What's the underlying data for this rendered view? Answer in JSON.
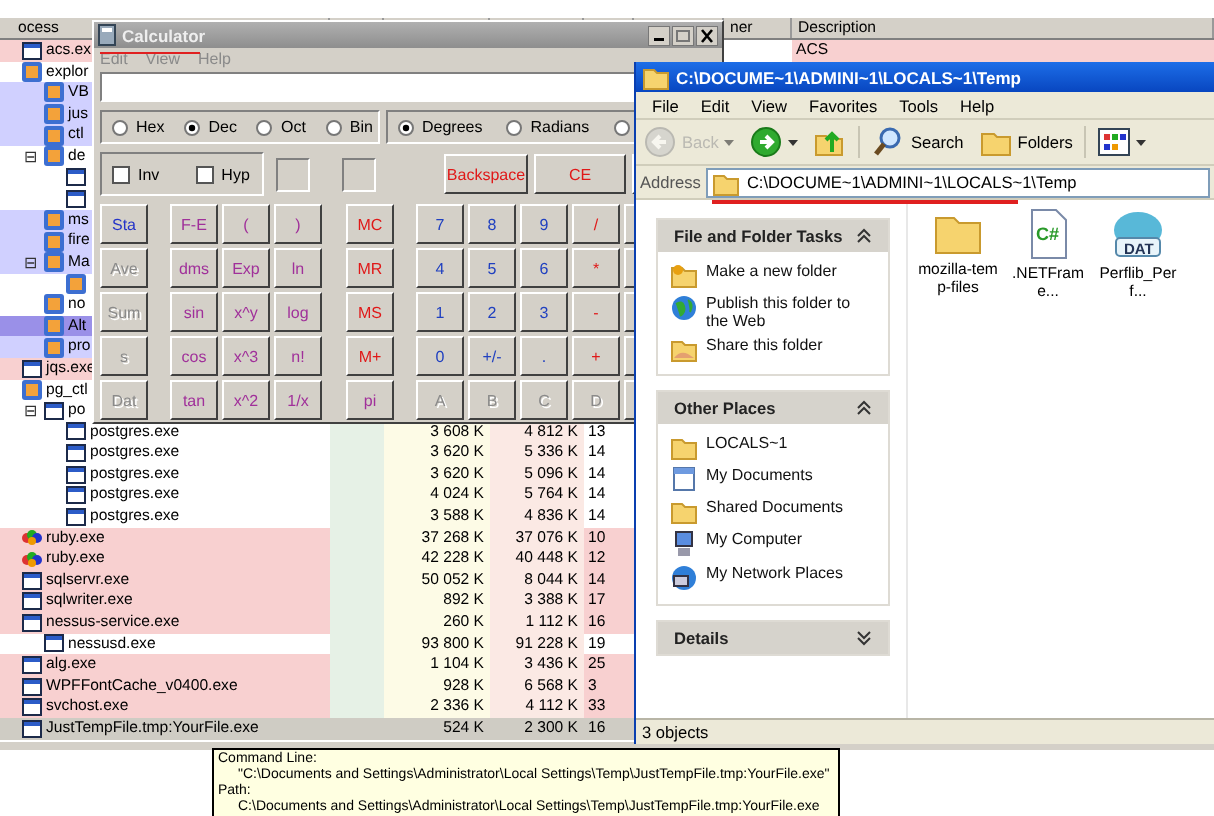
{
  "process_explorer": {
    "columns": [
      {
        "label": "ocess"
      },
      {
        "label": "ner"
      },
      {
        "label": "Description"
      }
    ],
    "processes": [
      {
        "name": "acs.ex",
        "kind": "window",
        "color": "#f8d0d0",
        "selected": false,
        "description": "ACS"
      },
      {
        "name": "explor",
        "kind": "app",
        "selected": false,
        "children": [
          {
            "name": "VB",
            "kind": "app",
            "color": "#d0d0ff",
            "selected": false
          },
          {
            "name": "jus",
            "kind": "app",
            "color": "#d0d0ff",
            "selected": false
          },
          {
            "name": "ctl",
            "kind": "app",
            "color": "#d0d0ff",
            "selected": false
          },
          {
            "name": "de",
            "kind": "app",
            "toggle": "⊟",
            "selected": false,
            "children": [
              {
                "kind": "window",
                "selected": false
              },
              {
                "kind": "window",
                "selected": false
              }
            ]
          },
          {
            "name": "ms",
            "kind": "app",
            "color": "#d0d0ff",
            "selected": false
          },
          {
            "name": "fire",
            "kind": "app",
            "color": "#d0d0ff",
            "selected": false
          },
          {
            "name": "Ma",
            "kind": "app",
            "toggle": "⊟",
            "color": "#d0d0ff",
            "selected": false,
            "children": [
              {
                "kind": "app",
                "selected": false
              }
            ]
          },
          {
            "name": "no",
            "kind": "app",
            "selected": false
          },
          {
            "name": "Alt",
            "kind": "app",
            "color": "#9a90e8",
            "selected": false
          },
          {
            "name": "pro",
            "kind": "app",
            "color": "#d0d0ff",
            "selected": false
          }
        ]
      },
      {
        "name": "jqs.exe",
        "kind": "window",
        "color": "#f8d0d0",
        "selected": false
      },
      {
        "name": "pg_ctl",
        "kind": "app",
        "selected": false,
        "children": [
          {
            "name": "po",
            "kind": "window",
            "toggle": "⊟",
            "selected": false,
            "children": [
              {
                "name": "postgres.exe",
                "kind": "window",
                "selected": false,
                "private_bytes": "3 608 K",
                "working_set": "4 812 K",
                "pid": "13"
              },
              {
                "name": "postgres.exe",
                "kind": "window",
                "selected": false,
                "private_bytes": "3 620 K",
                "working_set": "5 336 K",
                "pid": "14"
              },
              {
                "name": "postgres.exe",
                "kind": "window",
                "selected": false,
                "private_bytes": "3 620 K",
                "working_set": "5 096 K",
                "pid": "14"
              },
              {
                "name": "postgres.exe",
                "kind": "window",
                "selected": false,
                "private_bytes": "4 024 K",
                "working_set": "5 764 K",
                "pid": "14"
              },
              {
                "name": "postgres.exe",
                "kind": "window",
                "selected": false,
                "private_bytes": "3 588 K",
                "working_set": "4 836 K",
                "pid": "14"
              }
            ]
          }
        ]
      },
      {
        "name": "ruby.exe",
        "kind": "gem",
        "color": "#f8d0d0",
        "selected": false,
        "private_bytes": "37 268 K",
        "working_set": "37 076 K",
        "pid": "10"
      },
      {
        "name": "ruby.exe",
        "kind": "gem",
        "color": "#f8d0d0",
        "selected": false,
        "private_bytes": "42 228 K",
        "working_set": "40 448 K",
        "pid": "12"
      },
      {
        "name": "sqlservr.exe",
        "kind": "window",
        "color": "#f8d0d0",
        "selected": false,
        "private_bytes": "50 052 K",
        "working_set": "8 044 K",
        "pid": "14"
      },
      {
        "name": "sqlwriter.exe",
        "kind": "window",
        "color": "#f8d0d0",
        "selected": false,
        "private_bytes": "892 K",
        "working_set": "3 388 K",
        "pid": "17"
      },
      {
        "name": "nessus-service.exe",
        "kind": "window",
        "color": "#f8d0d0",
        "selected": false,
        "private_bytes": "260 K",
        "working_set": "1 112 K",
        "pid": "16",
        "children": [
          {
            "name": "nessusd.exe",
            "kind": "window",
            "selected": false,
            "private_bytes": "93 800 K",
            "working_set": "91 228 K",
            "pid": "19"
          }
        ]
      },
      {
        "name": "alg.exe",
        "kind": "window",
        "color": "#f8d0d0",
        "selected": false,
        "private_bytes": "1 104 K",
        "working_set": "3 436 K",
        "pid": "25"
      },
      {
        "name": "WPFFontCache_v0400.exe",
        "kind": "window",
        "color": "#f8d0d0",
        "selected": false,
        "private_bytes": "928 K",
        "working_set": "6 568 K",
        "pid": "3"
      },
      {
        "name": "svchost.exe",
        "kind": "window",
        "color": "#f8d0d0",
        "selected": false,
        "private_bytes": "2 336 K",
        "working_set": "4 112 K",
        "pid": "33"
      },
      {
        "name": "JustTempFile.tmp:YourFile.exe",
        "kind": "window",
        "selected": true,
        "annotated": true,
        "private_bytes": "524 K",
        "working_set": "2 300 K",
        "pid": "16"
      }
    ]
  },
  "calculator": {
    "title": "Calculator",
    "annotated": true,
    "menu": [
      "Edit",
      "View",
      "Help"
    ],
    "bases": [
      {
        "label": "Hex",
        "selected": false
      },
      {
        "label": "Dec",
        "selected": true
      },
      {
        "label": "Oct",
        "selected": false
      },
      {
        "label": "Bin",
        "selected": false
      }
    ],
    "angles": [
      {
        "label": "Degrees",
        "selected": true
      },
      {
        "label": "Radians",
        "selected": false
      },
      {
        "selected": false
      }
    ],
    "checks": [
      {
        "label": "Inv",
        "checked": false
      },
      {
        "label": "Hyp",
        "checked": false
      }
    ],
    "edit_keys": [
      "Backspace",
      "CE"
    ],
    "keys": [
      [
        {
          "label": "Sta",
          "kind": "stat",
          "disabled": false
        },
        {
          "label": "F-E",
          "kind": "func",
          "disabled": false
        },
        {
          "label": "(",
          "kind": "func",
          "disabled": false
        },
        {
          "label": ")",
          "kind": "func",
          "disabled": false
        },
        {
          "label": "MC",
          "kind": "mem",
          "disabled": false
        },
        {
          "label": "7",
          "kind": "digit",
          "disabled": false
        },
        {
          "label": "8",
          "kind": "digit",
          "disabled": false
        },
        {
          "label": "9",
          "kind": "digit",
          "disabled": false
        },
        {
          "label": "/",
          "kind": "op",
          "disabled": false
        },
        {
          "kind": "op"
        }
      ],
      [
        {
          "label": "Ave",
          "kind": "stat",
          "disabled": true
        },
        {
          "label": "dms",
          "kind": "func",
          "disabled": false
        },
        {
          "label": "Exp",
          "kind": "func",
          "disabled": false
        },
        {
          "label": "ln",
          "kind": "func",
          "disabled": false
        },
        {
          "label": "MR",
          "kind": "mem",
          "disabled": false
        },
        {
          "label": "4",
          "kind": "digit",
          "disabled": false
        },
        {
          "label": "5",
          "kind": "digit",
          "disabled": false
        },
        {
          "label": "6",
          "kind": "digit",
          "disabled": false
        },
        {
          "label": "*",
          "kind": "op",
          "disabled": false
        },
        {
          "kind": "op"
        }
      ],
      [
        {
          "label": "Sum",
          "kind": "stat",
          "disabled": true
        },
        {
          "label": "sin",
          "kind": "func",
          "disabled": false
        },
        {
          "label": "x^y",
          "kind": "func",
          "disabled": false
        },
        {
          "label": "log",
          "kind": "func",
          "disabled": false
        },
        {
          "label": "MS",
          "kind": "mem",
          "disabled": false
        },
        {
          "label": "1",
          "kind": "digit",
          "disabled": false
        },
        {
          "label": "2",
          "kind": "digit",
          "disabled": false
        },
        {
          "label": "3",
          "kind": "digit",
          "disabled": false
        },
        {
          "label": "-",
          "kind": "op",
          "disabled": false
        },
        {
          "kind": "op"
        }
      ],
      [
        {
          "label": "s",
          "kind": "stat",
          "disabled": true
        },
        {
          "label": "cos",
          "kind": "func",
          "disabled": false
        },
        {
          "label": "x^3",
          "kind": "func",
          "disabled": false
        },
        {
          "label": "n!",
          "kind": "func",
          "disabled": false
        },
        {
          "label": "M+",
          "kind": "mem",
          "disabled": false
        },
        {
          "label": "0",
          "kind": "digit",
          "disabled": false
        },
        {
          "label": "+/-",
          "kind": "digit",
          "disabled": false
        },
        {
          "label": ".",
          "kind": "digit",
          "disabled": false
        },
        {
          "label": "+",
          "kind": "op",
          "disabled": false
        },
        {
          "kind": "op"
        }
      ],
      [
        {
          "label": "Dat",
          "kind": "stat",
          "disabled": true
        },
        {
          "label": "tan",
          "kind": "func",
          "disabled": false
        },
        {
          "label": "x^2",
          "kind": "func",
          "disabled": false
        },
        {
          "label": "1/x",
          "kind": "func",
          "disabled": false
        },
        {
          "label": "pi",
          "kind": "func",
          "disabled": false
        },
        {
          "label": "A",
          "kind": "digit",
          "disabled": true
        },
        {
          "label": "B",
          "kind": "digit",
          "disabled": true
        },
        {
          "label": "C",
          "kind": "digit",
          "disabled": true
        },
        {
          "label": "D",
          "kind": "digit",
          "disabled": true
        },
        {
          "kind": "op"
        }
      ]
    ]
  },
  "explorer": {
    "title": "C:\\DOCUME~1\\ADMINI~1\\LOCALS~1\\Temp",
    "menu": [
      "File",
      "Edit",
      "View",
      "Favorites",
      "Tools",
      "Help"
    ],
    "toolbar": [
      {
        "kind": "back",
        "label": "Back",
        "disabled": true
      },
      {
        "kind": "forward",
        "disabled": false
      },
      {
        "kind": "up",
        "disabled": false
      },
      {
        "kind": "search",
        "label": "Search",
        "disabled": false
      },
      {
        "kind": "folders",
        "label": "Folders",
        "disabled": false
      },
      {
        "kind": "views",
        "disabled": false
      }
    ],
    "address": {
      "label": "Address",
      "value": "C:\\DOCUME~1\\ADMINI~1\\LOCALS~1\\Temp",
      "annotated": true
    },
    "panels": [
      {
        "title": "File and Folder Tasks",
        "expanded": true,
        "items": [
          {
            "label": "Make a new folder",
            "kind": "new-folder"
          },
          {
            "label": "Publish this folder to the Web",
            "kind": "globe"
          },
          {
            "label": "Share this folder",
            "kind": "share"
          }
        ]
      },
      {
        "title": "Other Places",
        "expanded": true,
        "items": [
          {
            "label": "LOCALS~1",
            "kind": "folder"
          },
          {
            "label": "My Documents",
            "kind": "documents"
          },
          {
            "label": "Shared Documents",
            "kind": "folder"
          },
          {
            "label": "My Computer",
            "kind": "computer"
          },
          {
            "label": "My Network Places",
            "kind": "network"
          }
        ]
      },
      {
        "title": "Details",
        "expanded": false
      }
    ],
    "files": [
      {
        "name": "mozilla-temp-files",
        "kind": "folder"
      },
      {
        "name": ".NETFrame...",
        "kind": "code",
        "badge": "C#"
      },
      {
        "name": "Perflib_Perf...",
        "kind": "data",
        "badge": "DAT"
      }
    ],
    "status": "3 objects"
  },
  "tooltip": {
    "lines": [
      {
        "kind": "label",
        "text": "Command Line:"
      },
      {
        "kind": "value",
        "text": "\"C:\\Documents and Settings\\Administrator\\Local Settings\\Temp\\JustTempFile.tmp:YourFile.exe\""
      },
      {
        "kind": "label",
        "text": "Path:"
      },
      {
        "kind": "value",
        "text": "C:\\Documents and Settings\\Administrator\\Local Settings\\Temp\\JustTempFile.tmp:YourFile.exe"
      }
    ]
  }
}
